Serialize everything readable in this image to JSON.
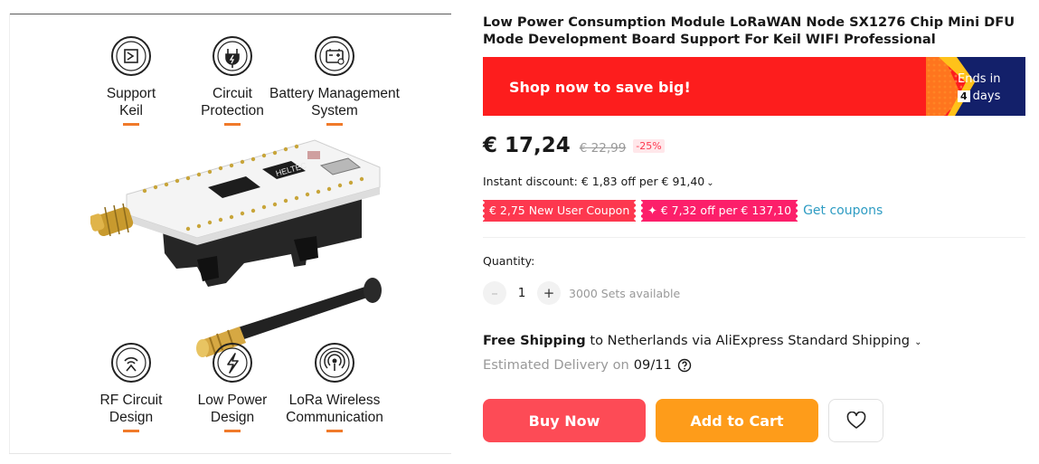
{
  "gallery": {
    "features_top": [
      {
        "icon": "keil-icon",
        "label": "Support\nKeil"
      },
      {
        "icon": "circuit-protection-icon",
        "label": "Circuit\nProtection"
      },
      {
        "icon": "battery-management-icon",
        "label": "Battery Management\nSystem"
      }
    ],
    "features_bottom": [
      {
        "icon": "rf-circuit-icon",
        "label": "RF Circuit\nDesign"
      },
      {
        "icon": "low-power-icon",
        "label": "Low Power\nDesign"
      },
      {
        "icon": "lora-wireless-icon",
        "label": "LoRa Wireless\nCommunication"
      }
    ],
    "board_silkscreen": "HELTEC",
    "accent_color": "#f07a2a"
  },
  "product": {
    "title": "Low Power Consumption Module LoRaWAN Node SX1276 Chip Mini DFU Mode Development Board Support For Keil WIFI Professional"
  },
  "banner": {
    "text": "Shop now to save big!",
    "ends_label": "Ends in",
    "ends_count": "4",
    "ends_unit": "days",
    "color": "#fd1d1d"
  },
  "pricing": {
    "price": "€ 17,24",
    "original_price": "€ 22,99",
    "discount": "-25%"
  },
  "instant_discount": {
    "text": "Instant discount: € 1,83 off per € 91,40"
  },
  "coupons": {
    "new_user": "€ 2,75 New User Coupon",
    "store": "✦ € 7,32 off per € 137,10",
    "get_link": "Get coupons"
  },
  "quantity": {
    "label": "Quantity:",
    "value": "1",
    "minus": "–",
    "plus": "+",
    "available": "3000 Sets available"
  },
  "shipping": {
    "free_label": "Free Shipping",
    "detail": " to Netherlands via AliExpress Standard Shipping",
    "delivery_label": "Estimated Delivery on",
    "delivery_date": "09/11"
  },
  "actions": {
    "buy_now": "Buy Now",
    "add_to_cart": "Add to Cart",
    "buy_color": "#fd4b56",
    "cart_color": "#fe9c1a"
  }
}
